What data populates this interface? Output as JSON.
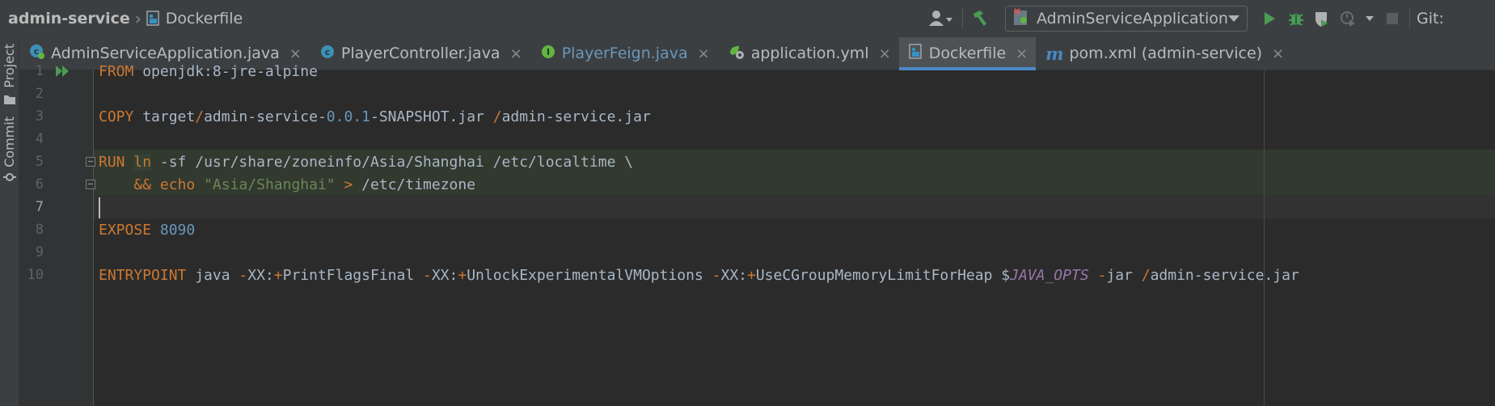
{
  "breadcrumb": {
    "project": "admin-service",
    "file": "Dockerfile"
  },
  "toolbar": {
    "run_config": "AdminServiceApplication",
    "git_label": "Git:",
    "icons": [
      "user-icon",
      "build-hammer-icon",
      "run-icon",
      "debug-icon",
      "coverage-icon",
      "profile-icon",
      "stop-icon"
    ]
  },
  "tool_windows": {
    "project": "Project",
    "commit": "Commit"
  },
  "tabs": [
    {
      "label": "AdminServiceApplication.java",
      "icon": "java-class-run-icon",
      "color": "#bbbbbb"
    },
    {
      "label": "PlayerController.java",
      "icon": "java-class-icon",
      "color": "#bbbbbb"
    },
    {
      "label": "PlayerFeign.java",
      "icon": "java-interface-icon",
      "color": "#6897bb"
    },
    {
      "label": "application.yml",
      "icon": "spring-config-icon",
      "color": "#bbbbbb"
    },
    {
      "label": "Dockerfile",
      "icon": "docker-icon",
      "color": "#bbbbbb",
      "active": true
    },
    {
      "label": "pom.xml (admin-service)",
      "icon": "maven-icon",
      "color": "#bbbbbb"
    }
  ],
  "editor": {
    "line_numbers": [
      "1",
      "2",
      "3",
      "4",
      "5",
      "6",
      "7",
      "8",
      "9",
      "10"
    ],
    "current_line": 7,
    "lines": {
      "l1": {
        "kw": "FROM",
        "rest": " openjdk:8-jre-alpine"
      },
      "l3": {
        "kw": "COPY",
        "a": " target",
        "slash1": "/",
        "b": "admin-service-",
        "ver0": "0",
        "dot1": ".",
        "ver1": "0",
        "dot2": ".",
        "ver2": "1",
        "c": "-SNAPSHOT.jar ",
        "slash2": "/",
        "d": "admin-service.jar"
      },
      "l5": {
        "kw": "RUN",
        "sp": " ",
        "ln": "ln",
        "rest": " -sf /usr/share/zoneinfo/Asia/Shanghai /etc/localtime \\"
      },
      "l6": {
        "indent": "    ",
        "amp": "&&",
        "sp1": " ",
        "echo": "echo",
        "sp2": " ",
        "str": "\"Asia/Shanghai\"",
        "sp3": " ",
        "gt": ">",
        "rest": " /etc/timezone"
      },
      "l8": {
        "kw": "EXPOSE",
        "sp": " ",
        "num": "8090"
      },
      "l10": {
        "kw": "ENTRYPOINT",
        "a": " java ",
        "o1": "-",
        "b": "XX:",
        "p1": "+",
        "c": "PrintFlagsFinal ",
        "o2": "-",
        "d": "XX:",
        "p2": "+",
        "e": "UnlockExperimentalVMOptions ",
        "o3": "-",
        "f": "XX:",
        "p3": "+",
        "g": "UseCGroupMemoryLimitForHeap $",
        "var": "JAVA_OPTS",
        "h": " ",
        "o4": "-",
        "i": "jar ",
        "slash": "/",
        "j": "admin-service.jar"
      }
    }
  }
}
